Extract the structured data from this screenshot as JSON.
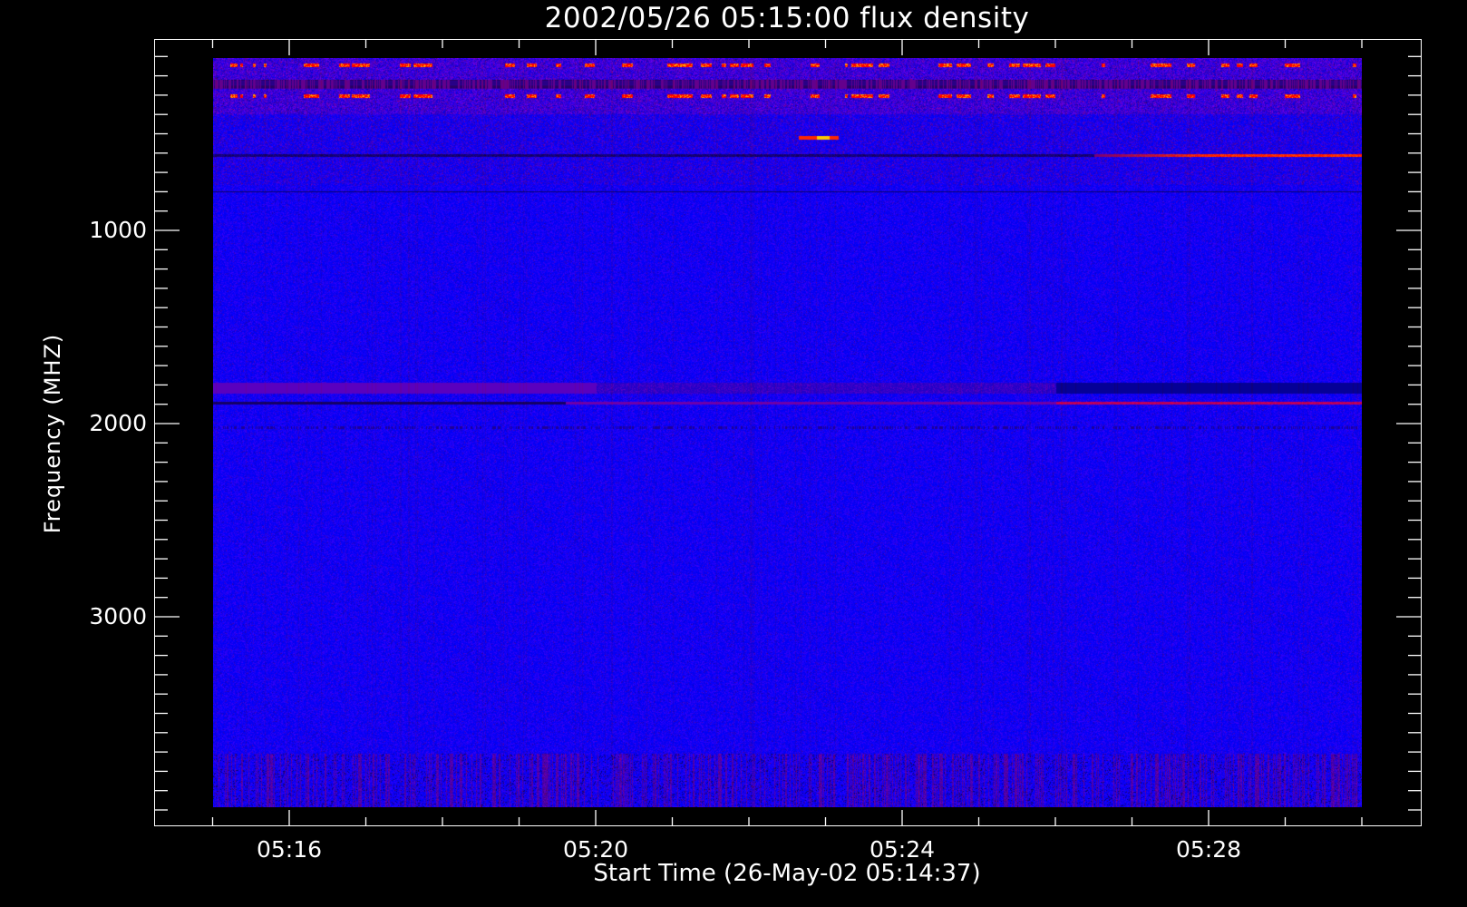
{
  "chart_data": {
    "type": "heatmap",
    "title": "2002/05/26 05:15:00 flux density",
    "xlabel": "Start Time (26-May-02 05:14:37)",
    "ylabel": "Frequency (MHZ)",
    "x_unit": "minutes after 05:00",
    "xlim": [
      14.23,
      30.8
    ],
    "x_data_range": [
      15,
      30
    ],
    "x_major_ticks": [
      16,
      20,
      24,
      28
    ],
    "x_tick_labels": [
      "05:16",
      "05:20",
      "05:24",
      "05:28"
    ],
    "x_minor_step": 1,
    "ylim": [
      4080,
      0
    ],
    "y_data_range": [
      100,
      4000
    ],
    "y_major_ticks": [
      1000,
      2000,
      3000
    ],
    "y_tick_labels": [
      "1000",
      "2000",
      "3000"
    ],
    "y_minor_step": 100,
    "grid": false,
    "colormap": {
      "background": "#0000ff",
      "low": "#000080",
      "mid": "#8000a0",
      "high": "#ff0000",
      "peak": "#ffd000"
    },
    "features": [
      {
        "name": "rfi-top-band",
        "freq_range": [
          100,
          400
        ]
      },
      {
        "name": "burst-spot",
        "time": 23.2,
        "freq": 520
      },
      {
        "name": "line-600MHz",
        "freq": 610,
        "brightening_after": 26.5
      },
      {
        "name": "band-1850MHz",
        "freq_range": [
          1790,
          1840
        ]
      },
      {
        "name": "line-1900MHz",
        "freq": 1890,
        "brightening_after": 26.0
      }
    ]
  }
}
